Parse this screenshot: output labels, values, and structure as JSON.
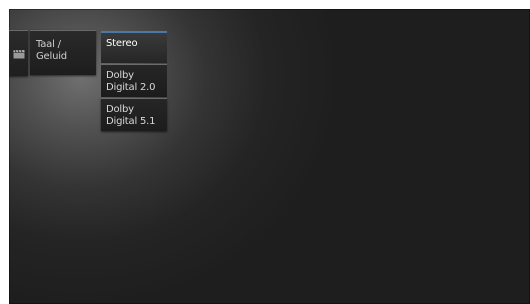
{
  "menu": {
    "icon": "clapperboard-icon",
    "tab_label": "Taal / Geluid"
  },
  "submenu": {
    "items": [
      {
        "label": "Stereo",
        "selected": true
      },
      {
        "label": "Dolby Digital 2.0",
        "selected": false
      },
      {
        "label": "Dolby Digital 5.1",
        "selected": false
      }
    ]
  },
  "colors": {
    "selection_accent": "#4a78a8",
    "background": "#1e1e1e"
  }
}
